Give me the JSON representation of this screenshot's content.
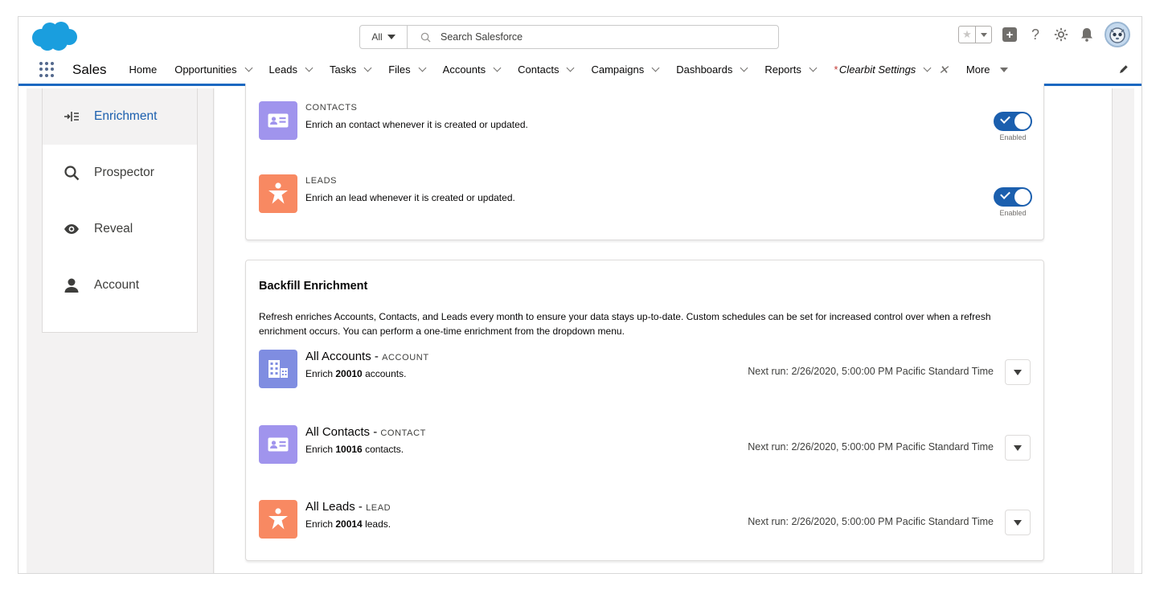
{
  "header": {
    "search_scope": "All",
    "search_placeholder": "Search Salesforce"
  },
  "nav": {
    "app_name": "Sales",
    "items": [
      {
        "label": "Home",
        "has_chevron": false
      },
      {
        "label": "Opportunities",
        "has_chevron": true
      },
      {
        "label": "Leads",
        "has_chevron": true
      },
      {
        "label": "Tasks",
        "has_chevron": true
      },
      {
        "label": "Files",
        "has_chevron": true
      },
      {
        "label": "Accounts",
        "has_chevron": true
      },
      {
        "label": "Contacts",
        "has_chevron": true
      },
      {
        "label": "Campaigns",
        "has_chevron": true
      },
      {
        "label": "Dashboards",
        "has_chevron": true
      },
      {
        "label": "Reports",
        "has_chevron": true
      }
    ],
    "active_tab": {
      "label": "Clearbit Settings",
      "marker": "*"
    },
    "more_label": "More"
  },
  "sidebar": {
    "items": [
      {
        "label": "Enrichment",
        "icon": "enrichment-icon",
        "active": true
      },
      {
        "label": "Prospector",
        "icon": "search-icon",
        "active": false
      },
      {
        "label": "Reveal",
        "icon": "eye-icon",
        "active": false
      },
      {
        "label": "Account",
        "icon": "user-icon",
        "active": false
      }
    ]
  },
  "auto_enrich": {
    "contacts": {
      "label": "CONTACTS",
      "description": "Enrich an contact whenever it is created or updated.",
      "toggle_label": "Enabled"
    },
    "leads": {
      "label": "LEADS",
      "description": "Enrich an lead whenever it is created or updated.",
      "toggle_label": "Enabled"
    }
  },
  "backfill": {
    "title": "Backfill Enrichment",
    "description": "Refresh enriches Accounts, Contacts, and Leads every month to ensure your data stays up-to-date. Custom schedules can be set for increased control over when a refresh enrichment occurs. You can perform a one-time enrichment from the dropdown menu.",
    "rows": [
      {
        "name": "All Accounts",
        "type": "ACCOUNT",
        "enrich_prefix": "Enrich",
        "count": "20010",
        "enrich_suffix": "accounts.",
        "next_run": "Next run: 2/26/2020, 5:00:00 PM Pacific Standard Time"
      },
      {
        "name": "All Contacts",
        "type": "CONTACT",
        "enrich_prefix": "Enrich",
        "count": "10016",
        "enrich_suffix": "contacts.",
        "next_run": "Next run: 2/26/2020, 5:00:00 PM Pacific Standard Time"
      },
      {
        "name": "All Leads",
        "type": "LEAD",
        "enrich_prefix": "Enrich",
        "count": "20014",
        "enrich_suffix": "leads.",
        "next_run": "Next run: 2/26/2020, 5:00:00 PM Pacific Standard Time"
      }
    ]
  },
  "colors": {
    "brand_blue": "#1b5fae",
    "contact_tile": "#a094ed",
    "lead_tile": "#f88962",
    "account_tile": "#7f8de1"
  }
}
